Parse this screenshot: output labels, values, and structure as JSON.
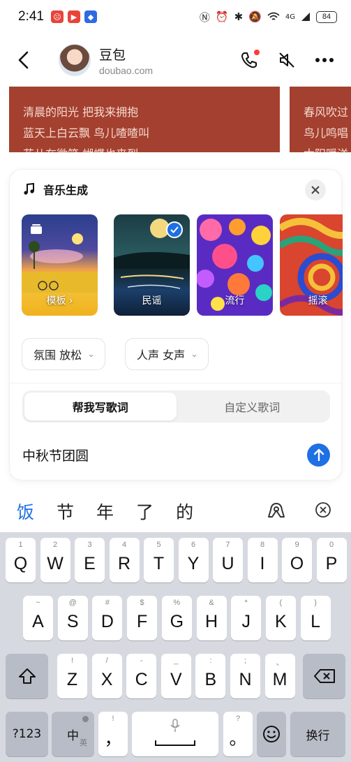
{
  "status_bar": {
    "time": "2:41",
    "battery": "84",
    "signal": "4G"
  },
  "header": {
    "name": "豆包",
    "domain": "doubao.com"
  },
  "lyrics": {
    "card1": [
      "清晨的阳光 把我来拥抱",
      "蓝天上白云飘 鸟儿喳喳叫",
      "花儿在微笑 蝴蝶也来到"
    ],
    "card2": [
      "春风吹过",
      "鸟儿鸣唱",
      "太阳暖洋"
    ]
  },
  "panel": {
    "title": "音乐生成",
    "styles": [
      {
        "label": "模板 ›",
        "selected": false
      },
      {
        "label": "民谣",
        "selected": true
      },
      {
        "label": "流行",
        "selected": false
      },
      {
        "label": "摇滚",
        "selected": false
      }
    ],
    "mood_chip": "氛围  放松",
    "voice_chip": "人声  女声",
    "tabs": [
      "帮我写歌词",
      "自定义歌词"
    ],
    "active_tab": 0,
    "input_value": "中秋节团圆"
  },
  "candidates": [
    "饭",
    "节",
    "年",
    "了",
    "的"
  ],
  "keyboard": {
    "row1": [
      [
        "1",
        "Q"
      ],
      [
        "2",
        "W"
      ],
      [
        "3",
        "E"
      ],
      [
        "4",
        "R"
      ],
      [
        "5",
        "T"
      ],
      [
        "6",
        "Y"
      ],
      [
        "7",
        "U"
      ],
      [
        "8",
        "I"
      ],
      [
        "9",
        "O"
      ],
      [
        "0",
        "P"
      ]
    ],
    "row2": [
      [
        "~",
        "A"
      ],
      [
        "@",
        "S"
      ],
      [
        "#",
        "D"
      ],
      [
        "$",
        "F"
      ],
      [
        "%",
        "G"
      ],
      [
        "&",
        "H"
      ],
      [
        "*",
        "J"
      ],
      [
        "(",
        "K"
      ],
      [
        ")",
        "L"
      ]
    ],
    "row3": [
      [
        "!",
        "Z"
      ],
      [
        "/",
        "X"
      ],
      [
        "-",
        "C"
      ],
      [
        "_",
        "V"
      ],
      [
        ":",
        "B"
      ],
      [
        ";",
        "N"
      ],
      [
        "、",
        "M"
      ]
    ],
    "num_key": "?123",
    "lang_key": "中",
    "lang_sub": "英",
    "comma_key": "，",
    "comma_sub": "!",
    "period_key": "。",
    "period_sub": "?",
    "enter_key": "换行"
  },
  "colors": {
    "accent": "#1f6fe5",
    "lyric_card": "#a4402f"
  }
}
